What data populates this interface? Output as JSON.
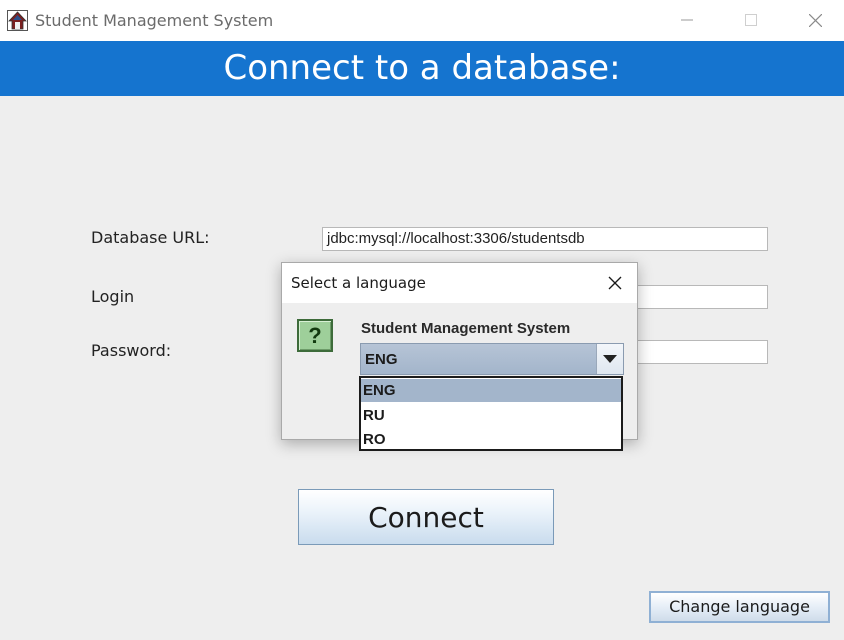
{
  "window": {
    "title": "Student Management System",
    "icons": {
      "app": "app-logo-icon",
      "minimize": "minimize-icon",
      "maximize": "maximize-icon",
      "close": "close-icon"
    }
  },
  "banner": {
    "text": "Connect to a database:",
    "color": "#1574cf"
  },
  "form": {
    "url_label": "Database URL:",
    "url_value": "jdbc:mysql://localhost:3306/studentsdb",
    "login_label": "Login",
    "login_value": "",
    "password_label": "Password:",
    "password_value": ""
  },
  "buttons": {
    "connect": "Connect",
    "change_language": "Change language"
  },
  "dialog": {
    "title": "Select a language",
    "message": "Student Management System",
    "icon": "question-icon",
    "question_glyph": "?",
    "selected": "ENG",
    "options": [
      "ENG",
      "RU",
      "RO"
    ],
    "selected_index": 0
  }
}
